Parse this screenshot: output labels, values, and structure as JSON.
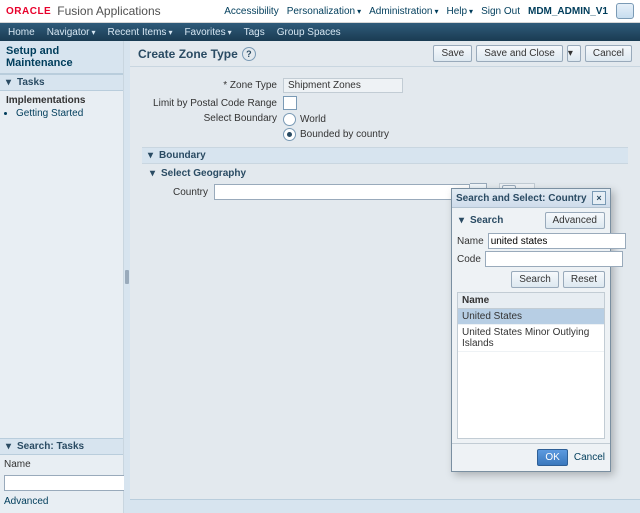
{
  "branding": {
    "logo": "ORACLE",
    "app": "Fusion Applications",
    "links": {
      "accessibility": "Accessibility",
      "personalization": "Personalization",
      "administration": "Administration",
      "help": "Help",
      "signout": "Sign Out"
    },
    "user": "MDM_ADMIN_V1"
  },
  "global_nav": {
    "home": "Home",
    "navigator": "Navigator",
    "recent": "Recent Items",
    "favorites": "Favorites",
    "tags": "Tags",
    "spaces": "Group Spaces"
  },
  "workarea_title": "Setup and Maintenance",
  "tasks_panel": {
    "title": "Tasks",
    "heading": "Implementations",
    "items": [
      "Getting Started"
    ]
  },
  "search_tasks": {
    "title": "Search: Tasks",
    "name_label": "Name",
    "name_value": "",
    "advanced": "Advanced"
  },
  "page": {
    "title": "Create Zone Type",
    "buttons": {
      "save": "Save",
      "save_close": "Save and Close",
      "cancel": "Cancel"
    }
  },
  "form": {
    "zone_type_label": "Zone Type",
    "zone_type_value": "Shipment Zones",
    "limit_label": "Limit by Postal Code Range",
    "select_boundary_label": "Select Boundary",
    "world": "World",
    "bounded": "Bounded by country",
    "boundary_section": "Boundary",
    "select_geo_section": "Select Geography",
    "country_label": "Country",
    "country_value": ""
  },
  "dialog": {
    "title": "Search and Select: Country",
    "search_section": "Search",
    "advanced_btn": "Advanced",
    "name_label": "Name",
    "name_value": "united states",
    "code_label": "Code",
    "code_value": "",
    "search_btn": "Search",
    "reset_btn": "Reset",
    "column": "Name",
    "results": [
      "United States",
      "United States Minor Outlying Islands"
    ],
    "ok": "OK",
    "cancel": "Cancel"
  }
}
